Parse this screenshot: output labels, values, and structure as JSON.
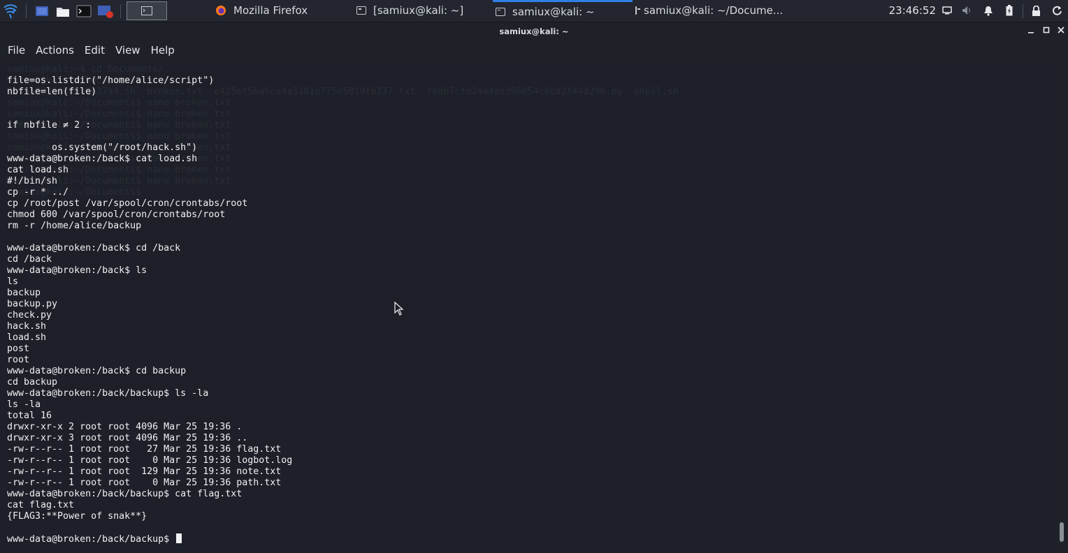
{
  "panel": {
    "tasks": [
      {
        "label": "Mozilla Firefox",
        "icon": "firefox-icon"
      },
      {
        "label": "[samiux@kali: ~]",
        "icon": "terminal-icon"
      },
      {
        "label": "samiux@kali: ~",
        "icon": "terminal-icon",
        "active": true
      },
      {
        "label": "samiux@kali: ~/Docume...",
        "icon": "terminal-icon"
      }
    ],
    "clock": "23:46:52",
    "accent_color": "#2f7fe6"
  },
  "window": {
    "title": "samiux@kali: ~",
    "menu": [
      "File",
      "Actions",
      "Edit",
      "View",
      "Help"
    ]
  },
  "terminal": {
    "background_ghost": [
      "samiux@kali:~$ cd Documents/",
      "samiux@kali:~/Documents$ ls",
      "7bd4b8336630839e37a4.sh  broken.txt  e425ef56a6ca4a3101e775d5019fb237.txt  fe8b7cfd24a4ad396054c8cd2f44d296.py  shell.sh",
      "samiux@kali:~/Documents$ nano broken.txt",
      "samiux@kali:~/Documents$ nano broken.txt",
      "samiux@kali:~/Documents$ nano broken.txt",
      "samiux@kali:~/Documents$ nano broken.txt",
      "samiux@kali:~/Documents$ nano broken.txt",
      "samiux@kali:~/Documents$ nano broken.txt",
      "samiux@kali:~/Documents$ nano broken.txt",
      "samiux@kali:~/Documents$ nano broken.txt",
      "samiux@kali:~/Documents$ "
    ],
    "lines": [
      "file=os.listdir(\"/home/alice/script\")",
      "nbfile=len(file)",
      "",
      "",
      "if nbfile ≠ 2 :",
      "",
      "        os.system(\"/root/hack.sh\")",
      "www-data@broken:/back$ cat load.sh",
      "cat load.sh",
      "#!/bin/sh",
      "cp -r * ../",
      "cp /root/post /var/spool/cron/crontabs/root",
      "chmod 600 /var/spool/cron/crontabs/root",
      "rm -r /home/alice/backup",
      "",
      "www-data@broken:/back$ cd /back",
      "cd /back",
      "www-data@broken:/back$ ls",
      "ls",
      "backup",
      "backup.py",
      "check.py",
      "hack.sh",
      "load.sh",
      "post",
      "root",
      "www-data@broken:/back$ cd backup",
      "cd backup",
      "www-data@broken:/back/backup$ ls -la",
      "ls -la",
      "total 16",
      "drwxr-xr-x 2 root root 4096 Mar 25 19:36 .",
      "drwxr-xr-x 3 root root 4096 Mar 25 19:36 ..",
      "-rw-r--r-- 1 root root   27 Mar 25 19:36 flag.txt",
      "-rw-r--r-- 1 root root    0 Mar 25 19:36 logbot.log",
      "-rw-r--r-- 1 root root  129 Mar 25 19:36 note.txt",
      "-rw-r--r-- 1 root root    0 Mar 25 19:36 path.txt",
      "www-data@broken:/back/backup$ cat flag.txt",
      "cat flag.txt",
      "{FLAG3:**Power of snak**}",
      ""
    ],
    "prompt": "www-data@broken:/back/backup$ "
  }
}
